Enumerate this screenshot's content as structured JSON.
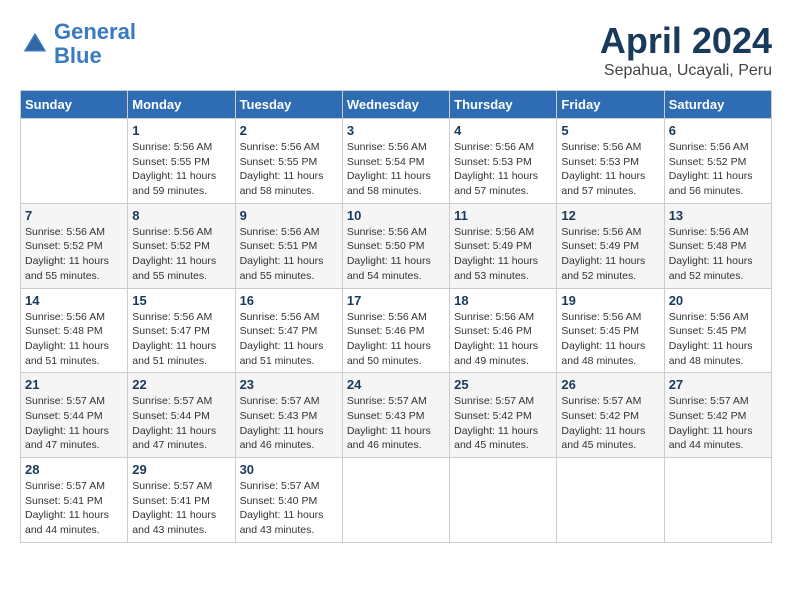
{
  "header": {
    "logo_line1": "General",
    "logo_line2": "Blue",
    "month_year": "April 2024",
    "location": "Sepahua, Ucayali, Peru"
  },
  "days_of_week": [
    "Sunday",
    "Monday",
    "Tuesday",
    "Wednesday",
    "Thursday",
    "Friday",
    "Saturday"
  ],
  "weeks": [
    [
      {
        "day": "",
        "info": ""
      },
      {
        "day": "1",
        "info": "Sunrise: 5:56 AM\nSunset: 5:55 PM\nDaylight: 11 hours\nand 59 minutes."
      },
      {
        "day": "2",
        "info": "Sunrise: 5:56 AM\nSunset: 5:55 PM\nDaylight: 11 hours\nand 58 minutes."
      },
      {
        "day": "3",
        "info": "Sunrise: 5:56 AM\nSunset: 5:54 PM\nDaylight: 11 hours\nand 58 minutes."
      },
      {
        "day": "4",
        "info": "Sunrise: 5:56 AM\nSunset: 5:53 PM\nDaylight: 11 hours\nand 57 minutes."
      },
      {
        "day": "5",
        "info": "Sunrise: 5:56 AM\nSunset: 5:53 PM\nDaylight: 11 hours\nand 57 minutes."
      },
      {
        "day": "6",
        "info": "Sunrise: 5:56 AM\nSunset: 5:52 PM\nDaylight: 11 hours\nand 56 minutes."
      }
    ],
    [
      {
        "day": "7",
        "info": ""
      },
      {
        "day": "8",
        "info": "Sunrise: 5:56 AM\nSunset: 5:52 PM\nDaylight: 11 hours\nand 55 minutes."
      },
      {
        "day": "9",
        "info": "Sunrise: 5:56 AM\nSunset: 5:51 PM\nDaylight: 11 hours\nand 55 minutes."
      },
      {
        "day": "10",
        "info": "Sunrise: 5:56 AM\nSunset: 5:50 PM\nDaylight: 11 hours\nand 54 minutes."
      },
      {
        "day": "11",
        "info": "Sunrise: 5:56 AM\nSunset: 5:49 PM\nDaylight: 11 hours\nand 53 minutes."
      },
      {
        "day": "12",
        "info": "Sunrise: 5:56 AM\nSunset: 5:49 PM\nDaylight: 11 hours\nand 52 minutes."
      },
      {
        "day": "13",
        "info": "Sunrise: 5:56 AM\nSunset: 5:48 PM\nDaylight: 11 hours\nand 52 minutes."
      }
    ],
    [
      {
        "day": "14",
        "info": ""
      },
      {
        "day": "15",
        "info": "Sunrise: 5:56 AM\nSunset: 5:47 PM\nDaylight: 11 hours\nand 51 minutes."
      },
      {
        "day": "16",
        "info": "Sunrise: 5:56 AM\nSunset: 5:47 PM\nDaylight: 11 hours\nand 51 minutes."
      },
      {
        "day": "17",
        "info": "Sunrise: 5:56 AM\nSunset: 5:46 PM\nDaylight: 11 hours\nand 50 minutes."
      },
      {
        "day": "18",
        "info": "Sunrise: 5:56 AM\nSunset: 5:46 PM\nDaylight: 11 hours\nand 49 minutes."
      },
      {
        "day": "19",
        "info": "Sunrise: 5:56 AM\nSunset: 5:45 PM\nDaylight: 11 hours\nand 48 minutes."
      },
      {
        "day": "20",
        "info": "Sunrise: 5:56 AM\nSunset: 5:45 PM\nDaylight: 11 hours\nand 48 minutes."
      }
    ],
    [
      {
        "day": "21",
        "info": ""
      },
      {
        "day": "22",
        "info": "Sunrise: 5:57 AM\nSunset: 5:44 PM\nDaylight: 11 hours\nand 47 minutes."
      },
      {
        "day": "23",
        "info": "Sunrise: 5:57 AM\nSunset: 5:43 PM\nDaylight: 11 hours\nand 46 minutes."
      },
      {
        "day": "24",
        "info": "Sunrise: 5:57 AM\nSunset: 5:43 PM\nDaylight: 11 hours\nand 46 minutes."
      },
      {
        "day": "25",
        "info": "Sunrise: 5:57 AM\nSunset: 5:42 PM\nDaylight: 11 hours\nand 45 minutes."
      },
      {
        "day": "26",
        "info": "Sunrise: 5:57 AM\nSunset: 5:42 PM\nDaylight: 11 hours\nand 45 minutes."
      },
      {
        "day": "27",
        "info": "Sunrise: 5:57 AM\nSunset: 5:42 PM\nDaylight: 11 hours\nand 44 minutes."
      }
    ],
    [
      {
        "day": "28",
        "info": "Sunrise: 5:57 AM\nSunset: 5:41 PM\nDaylight: 11 hours\nand 44 minutes."
      },
      {
        "day": "29",
        "info": "Sunrise: 5:57 AM\nSunset: 5:41 PM\nDaylight: 11 hours\nand 43 minutes."
      },
      {
        "day": "30",
        "info": "Sunrise: 5:57 AM\nSunset: 5:40 PM\nDaylight: 11 hours\nand 43 minutes."
      },
      {
        "day": "",
        "info": ""
      },
      {
        "day": "",
        "info": ""
      },
      {
        "day": "",
        "info": ""
      },
      {
        "day": "",
        "info": ""
      }
    ]
  ],
  "week7_day7_info": "Sunrise: 5:56 AM\nSunset: 5:52 PM\nDaylight: 11 hours\nand 55 minutes.",
  "week14_day14_info": "Sunrise: 5:56 AM\nSunset: 5:48 PM\nDaylight: 11 hours\nand 51 minutes.",
  "week21_day21_info": "Sunrise: 5:57 AM\nSunset: 5:44 PM\nDaylight: 11 hours\nand 47 minutes."
}
